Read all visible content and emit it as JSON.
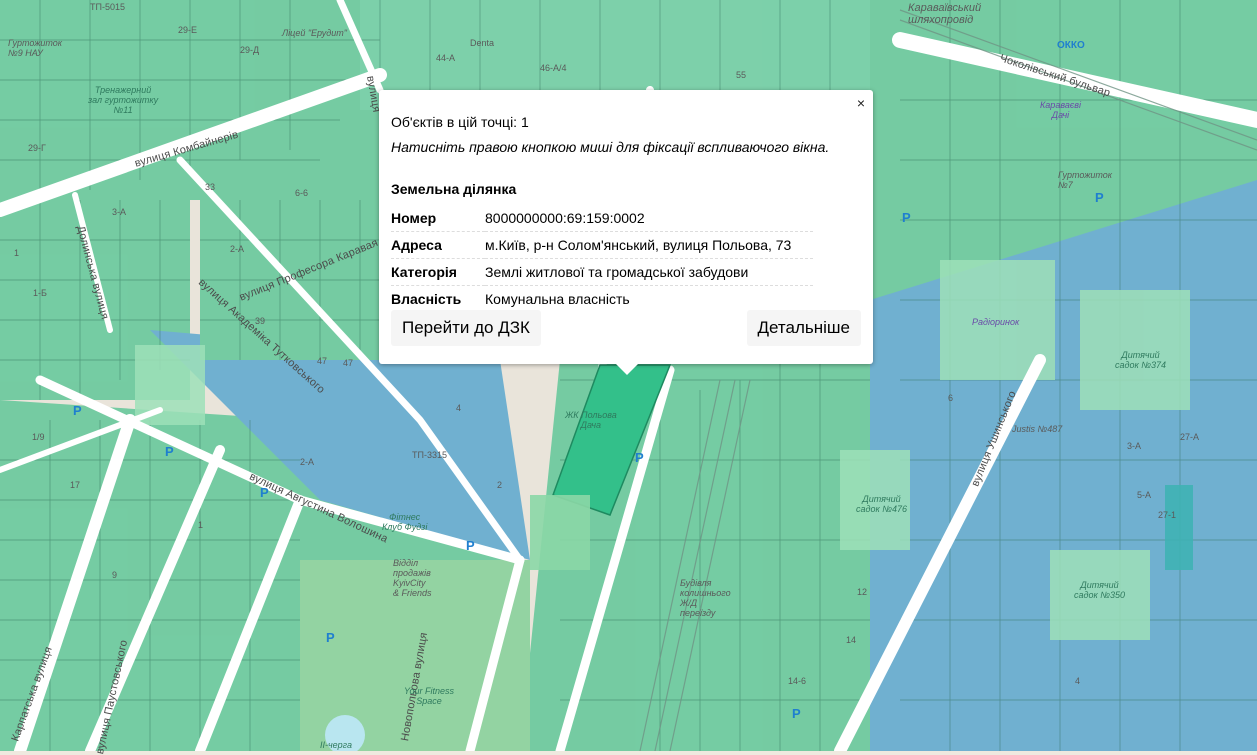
{
  "popup": {
    "close": "×",
    "count_text": "Об'єктів в цій точці: 1",
    "hint": "Натисніть правою кнопкою миші для фіксації вспливаючого вікна.",
    "section_title": "Земельна ділянка",
    "rows": [
      {
        "key": "Номер",
        "value": "8000000000:69:159:0002"
      },
      {
        "key": "Адреса",
        "value": "м.Київ, р-н Солом'янський, вулиця Польова, 73"
      },
      {
        "key": "Категорія",
        "value": "Землі житлової та громадської забудови"
      },
      {
        "key": "Власність",
        "value": "Комунальна власність"
      }
    ],
    "btn_dzk": "Перейти до ДЗК",
    "btn_details": "Детальніше"
  },
  "map": {
    "streets": {
      "kombainerov": "вулиця Комбайнерів",
      "dolynska": "Долинська вулиця",
      "karavaieva": "вулиця Професора Каравая",
      "tutkovskoho": "вулиця Академіка Тутковського",
      "volosyna": "вулиця Августина Волошина",
      "chokolivskyi": "Чоколівський бульвар",
      "ushynskoho": "вулиця Ушинського",
      "novopolova": "Новопольова вулиця",
      "karpatska": "Карпатська вулиця",
      "paustovskoho": "вулиця Паустовського",
      "poliova_short": "вулиця"
    },
    "pois": {
      "hurtozhytok9": "Гуртожиток\n№9 НАУ",
      "liceum": "Ліцей \"Ерудит\"",
      "trenazherni": "Тренажерний\nзал гуртожитку\n№11",
      "karavaivskyi": "Караваївський\nшляхопровід",
      "okko": "ОККО",
      "karavaivi_dachi": "Караваєві\nДачі",
      "hurtozhytok7": "Гуртожиток\n№7",
      "radiorynok": "Радіоринок",
      "sadok374": "Дитячий\nсадок №374",
      "justis": "Justis №487",
      "sadok476": "Дитячий\nсадок №476",
      "sadok350": "Дитячий\nсадок №350",
      "fitness": "Фітнес\nКлуб Фудзі",
      "viddil": "Відділ\nпродажів\nKyivCity\n& Friends",
      "your_fitness": "Your Fitness\nSpace",
      "budivlia": "Будівля\nколишнього\nЖ/Д\nпереїзду",
      "zhk": "ЖК Польова\nДача",
      "dental": "Denta",
      "tp5015": "ТП-5015",
      "tp3315": "ТП-3315",
      "ii_cherga": "ІІ-черга"
    },
    "house_numbers": [
      "29-Е",
      "29-Д",
      "29-Г",
      "33",
      "3-А",
      "6-6",
      "1-Б",
      "2-А",
      "39",
      "47",
      "47",
      "2-А",
      "2",
      "4",
      "46-А/4",
      "55",
      "44-А",
      "14-6",
      "12",
      "14",
      "27-1",
      "3-А",
      "4",
      "27-А",
      "5-А",
      "6",
      "1/9",
      "17",
      "9",
      "1",
      "1"
    ],
    "parking": "P",
    "colors": {
      "land": "#efe9df",
      "parcel_green": "#5fc59a",
      "parcel_blue": "#6eb6d0",
      "selected_parcel": "#3cc28e",
      "road": "#ffffff",
      "road_major": "#f2e7c3",
      "railway": "#7aa08e"
    }
  }
}
